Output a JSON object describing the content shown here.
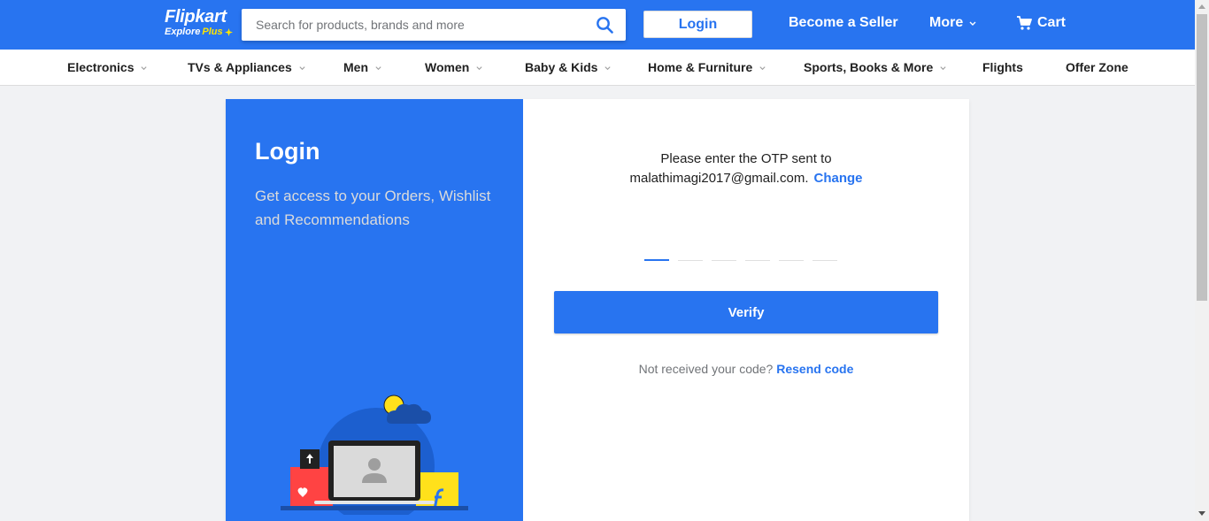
{
  "header": {
    "logo_main": "Flipkart",
    "logo_sub_explore": "Explore",
    "logo_sub_plus": "Plus",
    "search_placeholder": "Search for products, brands and more",
    "login_label": "Login",
    "seller_label": "Become a Seller",
    "more_label": "More",
    "cart_label": "Cart",
    "colors": {
      "brand": "#2874f0",
      "plus": "#ffe500"
    }
  },
  "categories": [
    {
      "label": "Electronics",
      "has_dropdown": true
    },
    {
      "label": "TVs & Appliances",
      "has_dropdown": true
    },
    {
      "label": "Men",
      "has_dropdown": true
    },
    {
      "label": "Women",
      "has_dropdown": true
    },
    {
      "label": "Baby & Kids",
      "has_dropdown": true
    },
    {
      "label": "Home & Furniture",
      "has_dropdown": true
    },
    {
      "label": "Sports, Books & More",
      "has_dropdown": true
    },
    {
      "label": "Flights",
      "has_dropdown": false
    },
    {
      "label": "Offer Zone",
      "has_dropdown": false
    }
  ],
  "login_panel": {
    "title": "Login",
    "description": "Get access to your Orders, Wishlist and Recommendations"
  },
  "otp": {
    "message_line1": "Please enter the OTP sent to",
    "email": "malathimagi2017@gmail.com.",
    "change_label": "Change",
    "digit_count": 6,
    "verify_label": "Verify",
    "resend_prompt": "Not received your code?",
    "resend_label": "Resend code"
  }
}
